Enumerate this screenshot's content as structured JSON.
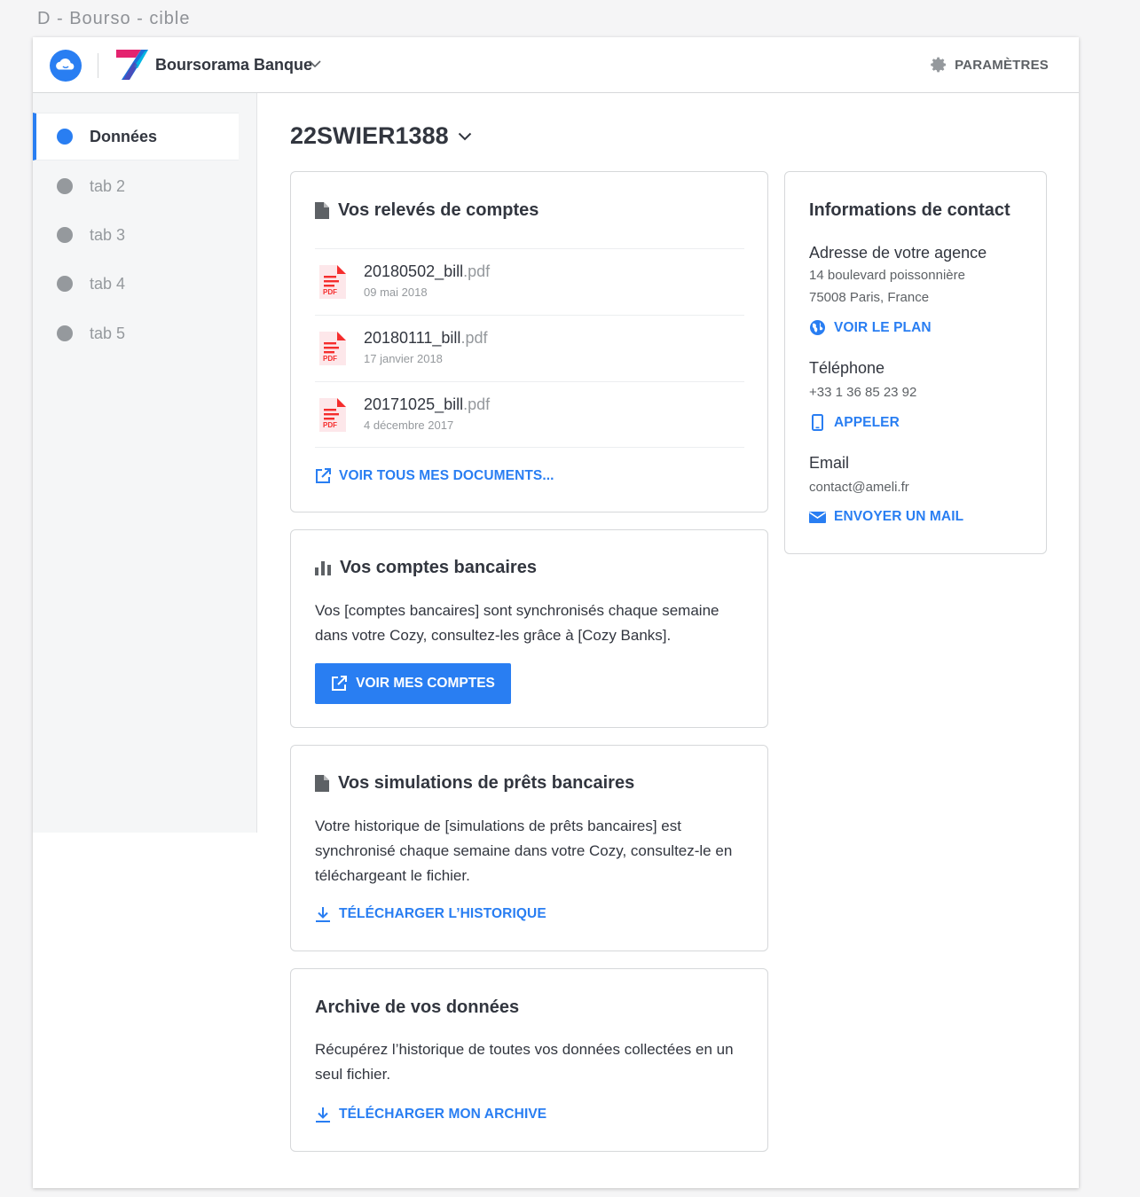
{
  "artboard_title": "D - Bourso - cible",
  "header": {
    "brand_name": "Boursorama Banque",
    "settings_label": "PARAMÈTRES"
  },
  "sidebar": {
    "items": [
      {
        "label": "Données"
      },
      {
        "label": "tab 2"
      },
      {
        "label": "tab 3"
      },
      {
        "label": "tab 4"
      },
      {
        "label": "tab 5"
      }
    ]
  },
  "main": {
    "account_id": "22SWIER1388",
    "statements": {
      "title": "Vos relevés de comptes",
      "documents": [
        {
          "name": "20180502_bill",
          "ext": ".pdf",
          "date": "09 mai 2018"
        },
        {
          "name": "20180111_bill",
          "ext": ".pdf",
          "date": "17 janvier 2018"
        },
        {
          "name": "20171025_bill",
          "ext": ".pdf",
          "date": "4 décembre 2017"
        }
      ],
      "pdf_badge": "PDF",
      "see_all_label": "VOIR TOUS MES DOCUMENTS..."
    },
    "bank_accounts": {
      "title": "Vos comptes bancaires",
      "text": "Vos [comptes bancaires] sont synchronisés chaque semaine dans votre Cozy, consultez-les grâce à [Cozy Banks].",
      "button_label": "VOIR MES COMPTES"
    },
    "loan_simulations": {
      "title": "Vos simulations de prêts bancaires",
      "text": "Votre historique de [simulations de prêts bancaires] est synchronisé chaque semaine dans votre Cozy, consultez-le en téléchargeant le fichier.",
      "download_label": "TÉLÉCHARGER L’HISTORIQUE"
    },
    "archive": {
      "title": "Archive de vos données",
      "text": "Récupérez l’historique de toutes vos données collectées en un seul fichier.",
      "download_label": "TÉLÉCHARGER MON ARCHIVE"
    }
  },
  "contact": {
    "title": "Informations de contact",
    "address_label": "Adresse de votre agence",
    "address_line1": "14 boulevard poissonnière",
    "address_line2": "75008 Paris, France",
    "map_label": "VOIR LE PLAN",
    "phone_label": "Téléphone",
    "phone_value": "+33 1 36 85 23 92",
    "call_label": "APPELER",
    "email_label": "Email",
    "email_value": "contact@ameli.fr",
    "mail_label": "ENVOYER UN MAIL"
  },
  "colors": {
    "accent": "#297ef2",
    "text": "#32363f",
    "muted": "#95999d",
    "pdf_red": "#f52d2d"
  }
}
